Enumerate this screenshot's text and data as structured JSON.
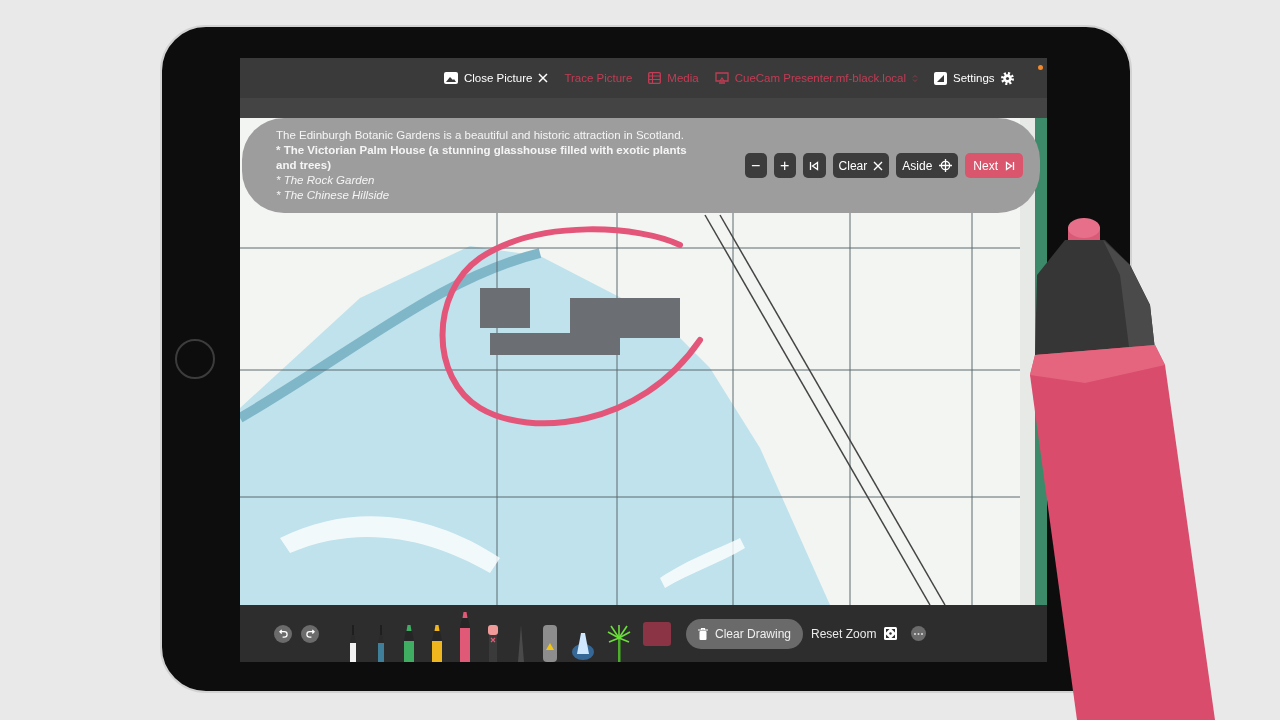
{
  "topbar": {
    "items": [
      {
        "kind": "close-picture",
        "label": "Close Picture",
        "accent": false
      },
      {
        "kind": "trace",
        "label": "Trace Picture",
        "accent": true
      },
      {
        "kind": "media",
        "label": "Media",
        "accent": true
      },
      {
        "kind": "device",
        "label": "CueCam Presenter.mf-black.local",
        "accent": true
      },
      {
        "kind": "settings",
        "label": "Settings",
        "accent": false
      }
    ]
  },
  "caption": {
    "lines": [
      {
        "kind": "plain",
        "text": "The Edinburgh Botanic Gardens is a beautiful and historic attraction in Scotland."
      },
      {
        "kind": "bold",
        "text": "* The Victorian Palm House (a stunning glasshouse filled with exotic plants and trees)"
      },
      {
        "kind": "italic",
        "text": "* The Rock Garden"
      },
      {
        "kind": "italic",
        "text": "* The Chinese Hillside"
      }
    ],
    "buttons": [
      {
        "kind": "zoom-out",
        "label": "−",
        "primary": false
      },
      {
        "kind": "zoom-in",
        "label": "+",
        "primary": false
      },
      {
        "kind": "restart",
        "primary": false
      },
      {
        "kind": "clear",
        "label": "Clear",
        "primary": false
      },
      {
        "kind": "aside",
        "label": "Aside",
        "primary": false
      },
      {
        "kind": "next",
        "label": "Next",
        "primary": true
      }
    ]
  },
  "toolbar": {
    "tools": [
      {
        "kind": "pen",
        "color": "#f2f2f2",
        "selected": false
      },
      {
        "kind": "pen",
        "color": "#3f7f99",
        "selected": false
      },
      {
        "kind": "marker",
        "color": "#3fae62",
        "selected": false
      },
      {
        "kind": "marker",
        "color": "#f0b61e",
        "selected": false
      },
      {
        "kind": "marker",
        "color": "#e05a78",
        "selected": true
      },
      {
        "kind": "eraser",
        "selected": false
      },
      {
        "kind": "pencil",
        "selected": false
      },
      {
        "kind": "spray",
        "selected": false
      },
      {
        "kind": "light",
        "selected": false
      },
      {
        "kind": "palm",
        "selected": false
      }
    ],
    "swatch": {
      "color": "#8a3445"
    },
    "buttons": [
      {
        "kind": "clear-drawing",
        "label": "Clear Drawing"
      },
      {
        "kind": "reset-zoom",
        "label": "Reset Zoom"
      }
    ]
  }
}
